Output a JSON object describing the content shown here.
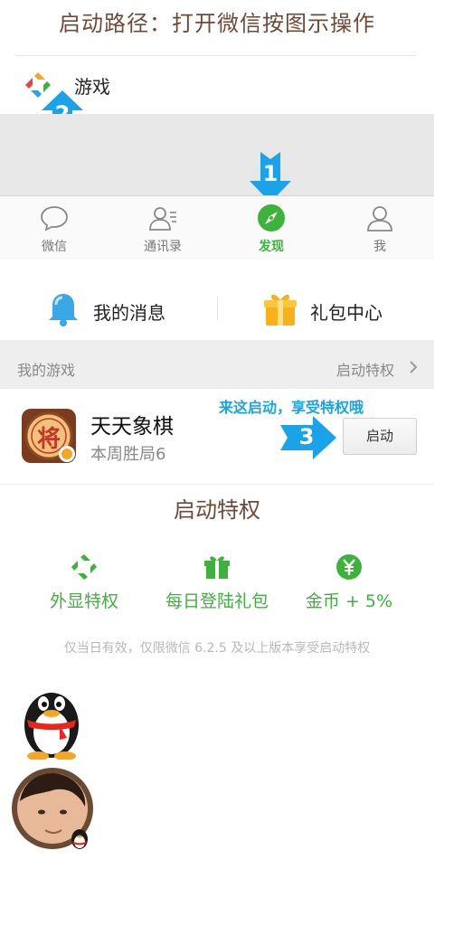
{
  "header": {
    "title": "启动路径：打开微信按图示操作"
  },
  "game_entry": {
    "label": "游戏"
  },
  "tabbar": {
    "tabs": [
      {
        "label": "微信",
        "icon": "chat-bubble-icon",
        "active": false
      },
      {
        "label": "通讯录",
        "icon": "contacts-icon",
        "active": false
      },
      {
        "label": "发现",
        "icon": "compass-icon",
        "active": true
      },
      {
        "label": "我",
        "icon": "person-icon",
        "active": false
      }
    ]
  },
  "steps": {
    "step1": "1",
    "step2": "2",
    "step3": "3"
  },
  "top_actions": {
    "messages": "我的消息",
    "gift_center": "礼包中心"
  },
  "section": {
    "my_games": "我的游戏",
    "launch_privilege": "启动特权"
  },
  "game": {
    "name": "天天象棋",
    "subtitle": "本周胜局6",
    "icon_char": "将",
    "hint": "来这启动，享受特权哦",
    "launch_button": "启动"
  },
  "privileges": {
    "title": "启动特权",
    "items": [
      {
        "label": "外显特权",
        "icon": "diamond-badge-icon"
      },
      {
        "label": "每日登陆礼包",
        "icon": "gift-icon"
      },
      {
        "label": "金币 + 5%",
        "icon": "yen-coin-icon"
      }
    ],
    "note": "仅当日有效，仅限微信 6.2.5 及以上版本享受启动特权"
  },
  "colors": {
    "accent_green": "#3db33b",
    "title_brown": "#6e4a36",
    "step_blue": "#1aa3e8"
  }
}
